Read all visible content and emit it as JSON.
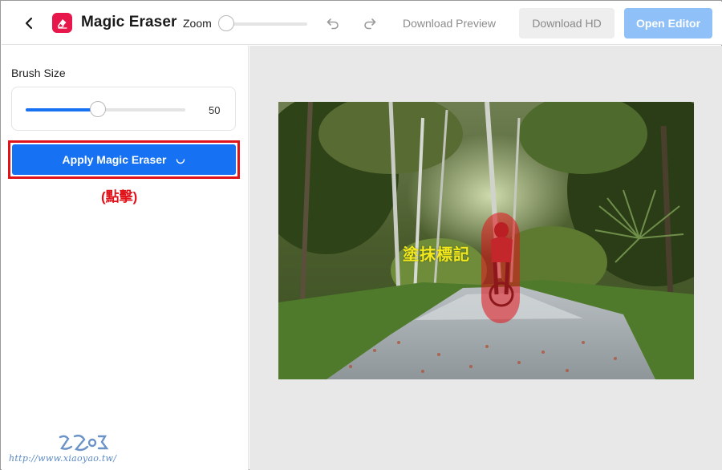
{
  "header": {
    "title": "Magic Eraser",
    "zoom_label": "Zoom",
    "zoom_level": 0,
    "download_preview": "Download Preview",
    "download_hd": "Download HD",
    "open_editor": "Open Editor"
  },
  "sidebar": {
    "brush_label": "Brush Size",
    "brush_value": "50",
    "brush_fraction": 0.45,
    "apply_label": "Apply Magic Eraser",
    "click_note": "(點擊)"
  },
  "canvas": {
    "paint_label": "塗抹標記"
  },
  "watermark": {
    "url": "http://www.xiaoyao.tw/"
  },
  "colors": {
    "accent": "#1672f3",
    "brand": "#e8174b",
    "highlight": "#e0131a",
    "paint_mark": "#e0131a",
    "annotation": "#f3e81a"
  },
  "icons": {
    "back": "chevron-left-icon",
    "logo": "magic-eraser-logo-icon",
    "undo": "undo-icon",
    "redo": "redo-icon",
    "spinner": "loading-spinner-icon"
  }
}
